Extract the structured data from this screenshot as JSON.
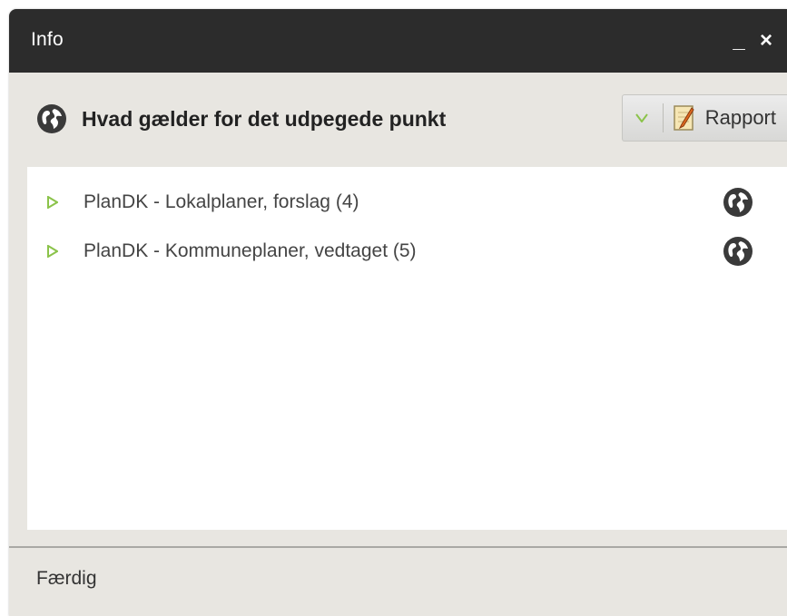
{
  "window": {
    "title": "Info",
    "minimize_label": "_",
    "close_label": "×"
  },
  "header": {
    "title": "Hvad gælder for det udpegede punkt",
    "rapport_label": "Rapport"
  },
  "list": {
    "items": [
      {
        "label": "PlanDK - Lokalplaner, forslag (4)"
      },
      {
        "label": "PlanDK - Kommuneplaner, vedtaget (5)"
      }
    ]
  },
  "status": {
    "text": "Færdig"
  },
  "colors": {
    "titlebar": "#2c2c2c",
    "panel": "#e8e6e1",
    "arrow": "#8bc34a",
    "globe": "#3a3a3a"
  },
  "icons": {
    "header": "globe-icon",
    "dropdown": "chevron-down-icon",
    "rapport": "report-icon",
    "item": "expand-arrow-icon",
    "item_action": "globe-icon"
  }
}
